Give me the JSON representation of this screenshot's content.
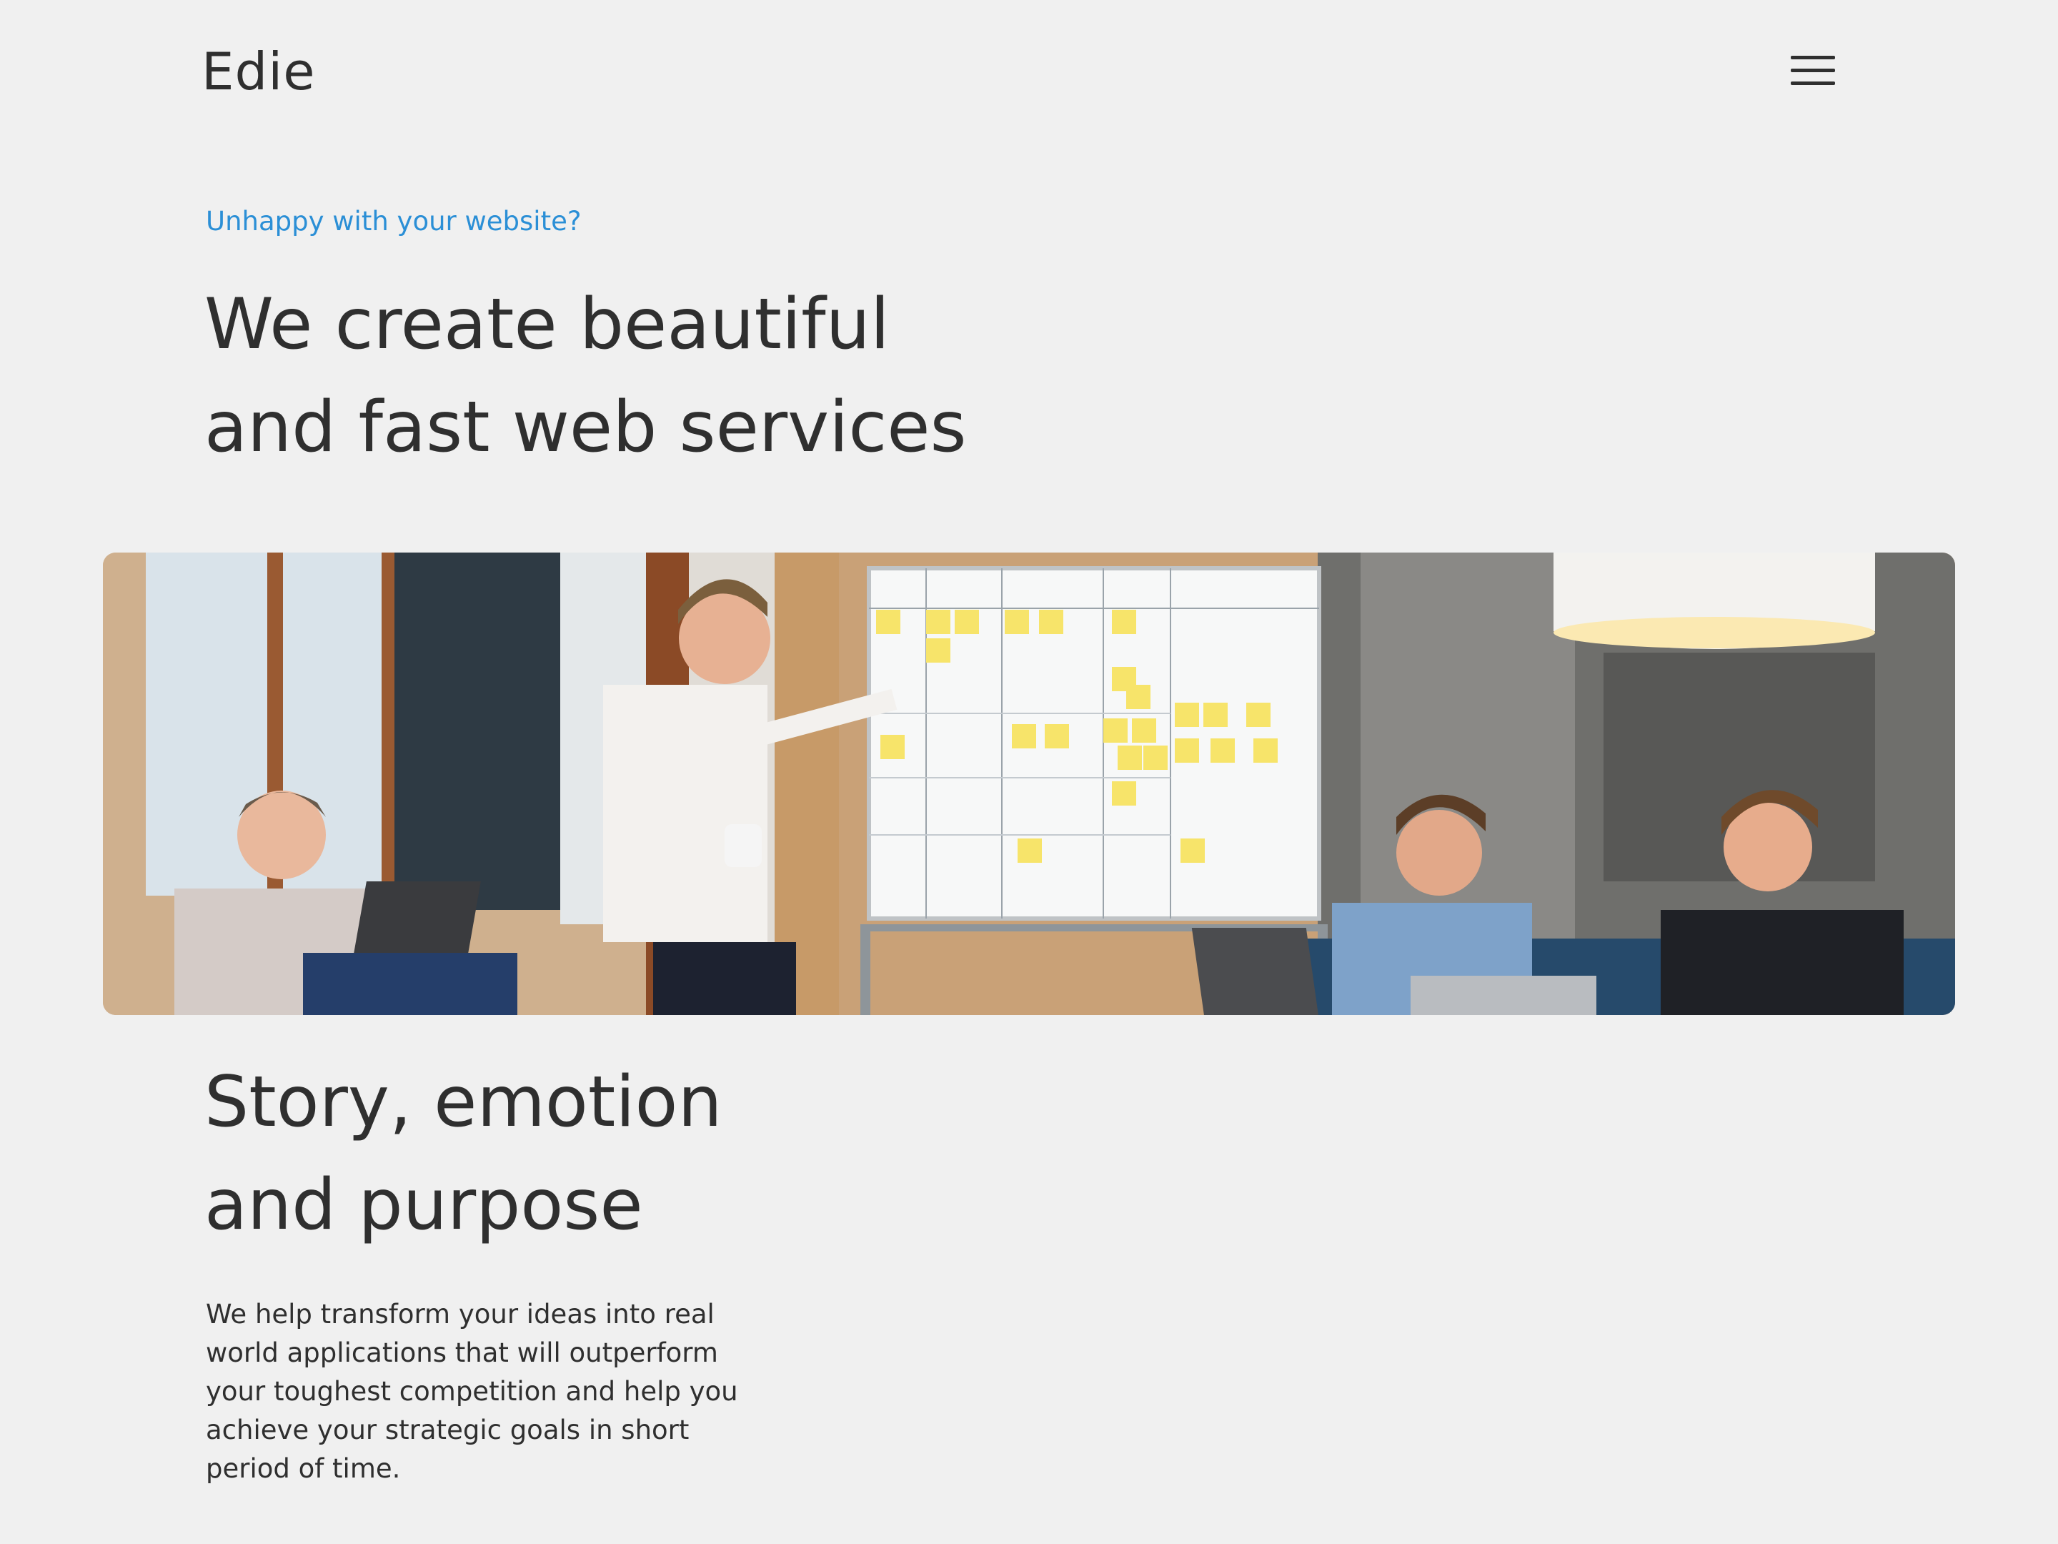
{
  "header": {
    "logo": "Edie",
    "menu_icon": "hamburger-menu-icon"
  },
  "hero": {
    "eyebrow": "Unhappy with your website?",
    "title_line1": "We create beautiful",
    "title_line2": "and fast web services"
  },
  "banner": {
    "description_icon": "team-meeting-photo"
  },
  "section": {
    "title_line1": "Story, emotion",
    "title_line2": "and purpose",
    "body": "We help transform your ideas into real world applications that will outperform your toughest competition and help you achieve your strategic goals in short period of time."
  },
  "colors": {
    "background": "#f0f0f0",
    "text": "#2f2f2f",
    "accent": "#2b8fd6"
  }
}
